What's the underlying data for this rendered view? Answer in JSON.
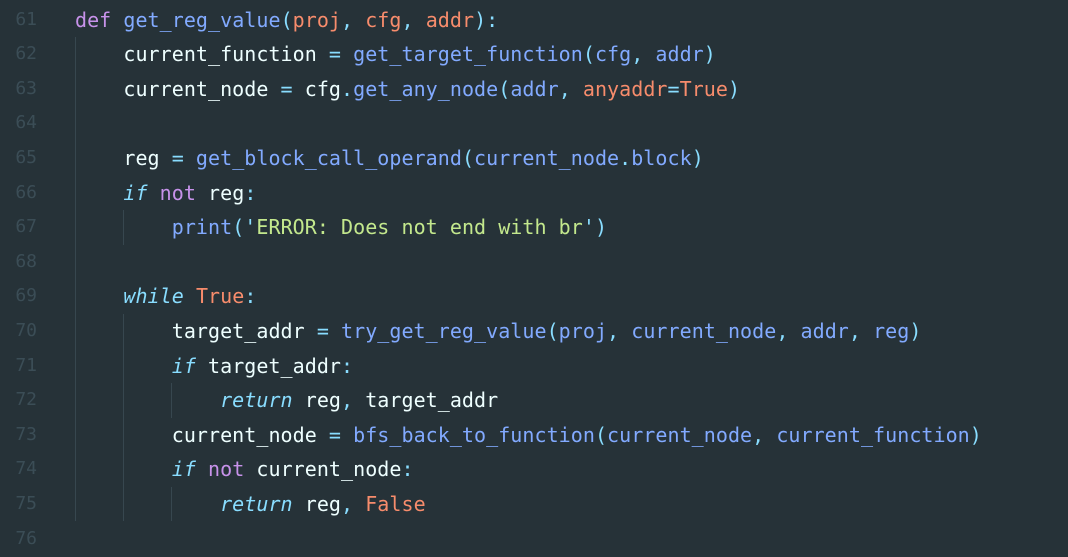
{
  "lines": [
    {
      "number": "61",
      "tokens": [
        {
          "t": "kw",
          "v": "def"
        },
        {
          "t": "pl",
          "v": " "
        },
        {
          "t": "fn",
          "v": "get_reg_value"
        },
        {
          "t": "op",
          "v": "("
        },
        {
          "t": "pm",
          "v": "proj"
        },
        {
          "t": "op",
          "v": ", "
        },
        {
          "t": "pm",
          "v": "cfg"
        },
        {
          "t": "op",
          "v": ", "
        },
        {
          "t": "pm",
          "v": "addr"
        },
        {
          "t": "op",
          "v": "):"
        }
      ]
    },
    {
      "number": "62",
      "tokens": [
        {
          "t": "pl",
          "v": "    current_function"
        },
        {
          "t": "op",
          "v": " = "
        },
        {
          "t": "fn",
          "v": "get_target_function"
        },
        {
          "t": "op",
          "v": "("
        },
        {
          "t": "fn",
          "v": "cfg"
        },
        {
          "t": "op",
          "v": ", "
        },
        {
          "t": "fn",
          "v": "addr"
        },
        {
          "t": "op",
          "v": ")"
        }
      ]
    },
    {
      "number": "63",
      "tokens": [
        {
          "t": "pl",
          "v": "    current_node"
        },
        {
          "t": "op",
          "v": " = "
        },
        {
          "t": "pl",
          "v": "cfg"
        },
        {
          "t": "op",
          "v": "."
        },
        {
          "t": "fn",
          "v": "get_any_node"
        },
        {
          "t": "op",
          "v": "("
        },
        {
          "t": "fn",
          "v": "addr"
        },
        {
          "t": "op",
          "v": ", "
        },
        {
          "t": "pm",
          "v": "anyaddr"
        },
        {
          "t": "op",
          "v": "="
        },
        {
          "t": "bo",
          "v": "True"
        },
        {
          "t": "op",
          "v": ")"
        }
      ]
    },
    {
      "number": "64",
      "tokens": []
    },
    {
      "number": "65",
      "tokens": [
        {
          "t": "pl",
          "v": "    reg"
        },
        {
          "t": "op",
          "v": " = "
        },
        {
          "t": "fn",
          "v": "get_block_call_operand"
        },
        {
          "t": "op",
          "v": "("
        },
        {
          "t": "fn",
          "v": "current_node"
        },
        {
          "t": "op",
          "v": "."
        },
        {
          "t": "fn",
          "v": "block"
        },
        {
          "t": "op",
          "v": ")"
        }
      ]
    },
    {
      "number": "66",
      "tokens": [
        {
          "t": "pl",
          "v": "    "
        },
        {
          "t": "it",
          "v": "if"
        },
        {
          "t": "pl",
          "v": " "
        },
        {
          "t": "kw",
          "v": "not"
        },
        {
          "t": "pl",
          "v": " reg"
        },
        {
          "t": "op",
          "v": ":"
        }
      ]
    },
    {
      "number": "67",
      "tokens": [
        {
          "t": "pl",
          "v": "        "
        },
        {
          "t": "fn",
          "v": "print"
        },
        {
          "t": "op",
          "v": "("
        },
        {
          "t": "op",
          "v": "'"
        },
        {
          "t": "st",
          "v": "ERROR: Does not end with br"
        },
        {
          "t": "op",
          "v": "'"
        },
        {
          "t": "op",
          "v": ")"
        }
      ]
    },
    {
      "number": "68",
      "tokens": []
    },
    {
      "number": "69",
      "tokens": [
        {
          "t": "pl",
          "v": "    "
        },
        {
          "t": "it",
          "v": "while"
        },
        {
          "t": "pl",
          "v": " "
        },
        {
          "t": "bo",
          "v": "True"
        },
        {
          "t": "op",
          "v": ":"
        }
      ]
    },
    {
      "number": "70",
      "tokens": [
        {
          "t": "pl",
          "v": "        target_addr"
        },
        {
          "t": "op",
          "v": " = "
        },
        {
          "t": "fn",
          "v": "try_get_reg_value"
        },
        {
          "t": "op",
          "v": "("
        },
        {
          "t": "fn",
          "v": "proj"
        },
        {
          "t": "op",
          "v": ", "
        },
        {
          "t": "fn",
          "v": "current_node"
        },
        {
          "t": "op",
          "v": ", "
        },
        {
          "t": "fn",
          "v": "addr"
        },
        {
          "t": "op",
          "v": ", "
        },
        {
          "t": "fn",
          "v": "reg"
        },
        {
          "t": "op",
          "v": ")"
        }
      ]
    },
    {
      "number": "71",
      "tokens": [
        {
          "t": "pl",
          "v": "        "
        },
        {
          "t": "it",
          "v": "if"
        },
        {
          "t": "pl",
          "v": " target_addr"
        },
        {
          "t": "op",
          "v": ":"
        }
      ]
    },
    {
      "number": "72",
      "tokens": [
        {
          "t": "pl",
          "v": "            "
        },
        {
          "t": "it",
          "v": "return"
        },
        {
          "t": "pl",
          "v": " reg"
        },
        {
          "t": "op",
          "v": ", "
        },
        {
          "t": "pl",
          "v": "target_addr"
        }
      ]
    },
    {
      "number": "73",
      "tokens": [
        {
          "t": "pl",
          "v": "        current_node"
        },
        {
          "t": "op",
          "v": " = "
        },
        {
          "t": "fn",
          "v": "bfs_back_to_function"
        },
        {
          "t": "op",
          "v": "("
        },
        {
          "t": "fn",
          "v": "current_node"
        },
        {
          "t": "op",
          "v": ", "
        },
        {
          "t": "fn",
          "v": "current_function"
        },
        {
          "t": "op",
          "v": ")"
        }
      ]
    },
    {
      "number": "74",
      "tokens": [
        {
          "t": "pl",
          "v": "        "
        },
        {
          "t": "it",
          "v": "if"
        },
        {
          "t": "pl",
          "v": " "
        },
        {
          "t": "kw",
          "v": "not"
        },
        {
          "t": "pl",
          "v": " current_node"
        },
        {
          "t": "op",
          "v": ":"
        }
      ]
    },
    {
      "number": "75",
      "tokens": [
        {
          "t": "pl",
          "v": "            "
        },
        {
          "t": "it",
          "v": "return"
        },
        {
          "t": "pl",
          "v": " reg"
        },
        {
          "t": "op",
          "v": ", "
        },
        {
          "t": "bo",
          "v": "False"
        }
      ]
    },
    {
      "number": "76",
      "tokens": []
    }
  ],
  "theme": {
    "background": "#263238",
    "line_number": "#3b4d56",
    "keyword": "#c792ea",
    "function": "#82aaff",
    "parameter": "#f78c6c",
    "plain": "#eeffff",
    "operator": "#89ddff",
    "string": "#c3e88d"
  }
}
